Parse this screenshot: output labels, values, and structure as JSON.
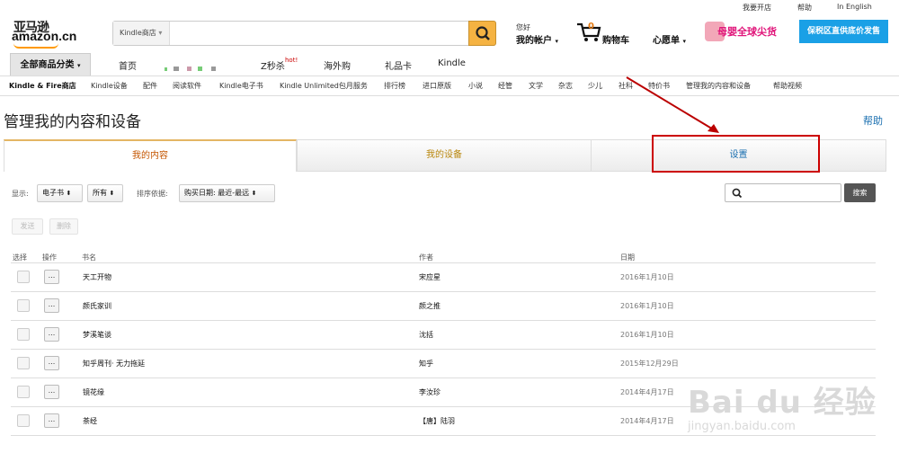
{
  "top_links": [
    "我要开店",
    "帮助",
    "In English"
  ],
  "logo": {
    "cn": "亚马逊",
    "en": "amazon.cn"
  },
  "search": {
    "category": "Kindle商店",
    "placeholder": ""
  },
  "account": {
    "greeting": "您好",
    "label": "我的帐户"
  },
  "cart": {
    "count": "0",
    "label": "购物车"
  },
  "wishlist": "心愿单",
  "banner": {
    "text1": "母婴全球尖货",
    "text2": "保税区直供底价发售"
  },
  "nav": {
    "category_button": "全部商品分类",
    "links": [
      "首页",
      "Z秒杀",
      "海外购",
      "礼品卡",
      "Kindle"
    ],
    "hot": "hot!"
  },
  "subnav": [
    "Kindle & Fire商店",
    "Kindle设备",
    "配件",
    "阅读软件",
    "Kindle电子书",
    "Kindle Unlimited包月服务",
    "排行榜",
    "进口原版",
    "小说",
    "经管",
    "文学",
    "杂志",
    "少儿",
    "社科",
    "特价书",
    "管理我的内容和设备",
    "帮助视频"
  ],
  "page_title": "管理我的内容和设备",
  "help": "帮助",
  "tabs": [
    "我的内容",
    "我的设备",
    "设置"
  ],
  "filters": {
    "show_label": "显示:",
    "type": "电子书",
    "scope": "所有",
    "sort_label": "排序依据:",
    "sort": "购买日期: 最近-最远",
    "search_button": "搜索"
  },
  "actions": [
    "发送",
    "删除"
  ],
  "table": {
    "headers": [
      "选择",
      "操作",
      "书名",
      "作者",
      "日期"
    ],
    "rows": [
      {
        "title": "天工开物",
        "author": "宋应星",
        "date": "2016年1月10日"
      },
      {
        "title": "颜氏家训",
        "author": "颜之推",
        "date": "2016年1月10日"
      },
      {
        "title": "梦溪笔谈",
        "author": "沈括",
        "date": "2016年1月10日"
      },
      {
        "title": "知乎周刊· 无力拖延",
        "author": "知乎",
        "date": "2015年12月29日"
      },
      {
        "title": "镜花缘",
        "author": "李汝珍",
        "date": "2014年4月17日"
      },
      {
        "title": "茶经",
        "author": "【唐】陆羽",
        "date": "2014年4月17日"
      }
    ],
    "row_button": "..."
  },
  "watermark": {
    "brand": "Bai du 经验",
    "url": "jingyan.baidu.com"
  },
  "colors": {
    "accent_orange": "#c45500",
    "search_button": "#f5b342",
    "highlight_red": "#cc0000",
    "link_blue": "#1a6fb0"
  }
}
